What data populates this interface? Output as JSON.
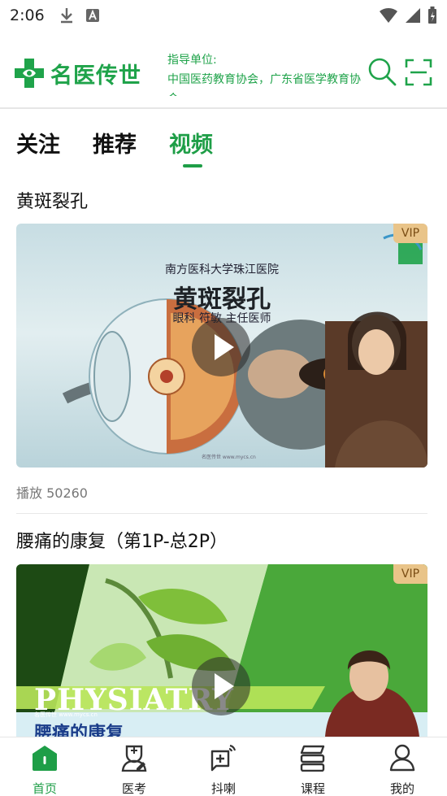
{
  "status_bar": {
    "time": "2:06"
  },
  "header": {
    "logo_text": "名医传世",
    "guide_label": "指导单位:",
    "guide_units": "中国医药教育协会，广东省医学教育协会"
  },
  "tabs": [
    {
      "label": "关注"
    },
    {
      "label": "推荐"
    },
    {
      "label": "视频",
      "active": true
    }
  ],
  "videos": [
    {
      "title": "黄斑裂孔",
      "badge": "VIP",
      "plays": "播放 50260",
      "thumb_text": {
        "hospital": "南方医科大学珠江医院",
        "topic": "黄斑裂孔",
        "doctor": "眼科  符敏  主任医师",
        "watermark": "名医传世 www.mycs.cn"
      }
    },
    {
      "title": "腰痛的康复（第1P-总2P）",
      "badge": "VIP",
      "thumb_text": {
        "banner": "PHYSIATRY",
        "topic": "腰痛的康复",
        "watermark": "名医传世 www.mycs.cn"
      }
    }
  ],
  "bottom_nav": [
    {
      "label": "首页",
      "icon": "home-icon",
      "active": true
    },
    {
      "label": "医考",
      "icon": "doctor-exam-icon"
    },
    {
      "label": "抖喇",
      "icon": "add-broadcast-icon"
    },
    {
      "label": "课程",
      "icon": "course-stack-icon"
    },
    {
      "label": "我的",
      "icon": "user-icon"
    }
  ],
  "colors": {
    "brand": "#1fa34a",
    "vip_bg": "#e9c489",
    "vip_text": "#7a4d14"
  }
}
